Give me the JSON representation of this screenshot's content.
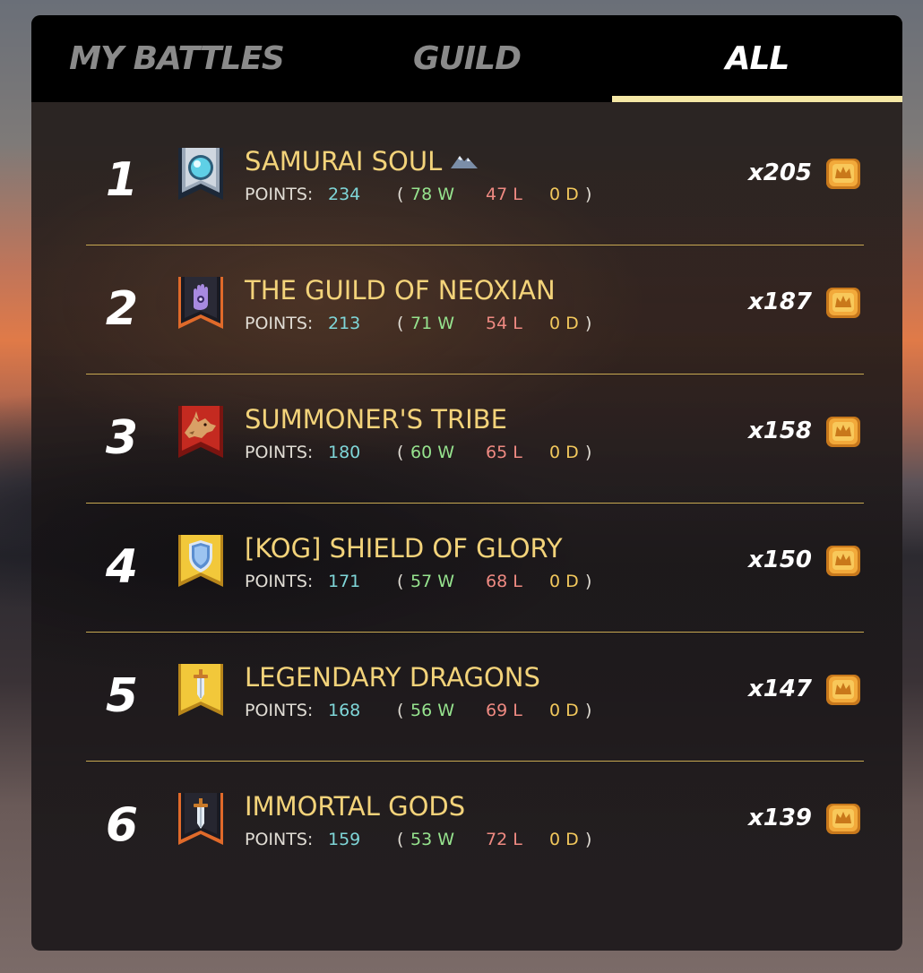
{
  "tabs": [
    {
      "label": "MY BATTLES",
      "active": false
    },
    {
      "label": "GUILD",
      "active": false
    },
    {
      "label": "ALL",
      "active": true
    }
  ],
  "colors": {
    "gold_text": "#f3d37a",
    "points": "#7fd6d8",
    "wins": "#96e38e",
    "losses": "#ef8a82",
    "draws": "#f2c85c",
    "active_tab_underline": "#f4e7a5"
  },
  "labels": {
    "points": "POINTS:",
    "paren_open": "(",
    "paren_close": ")"
  },
  "guilds": [
    {
      "rank": "1",
      "name": "SAMURAI SOUL",
      "icon": "orb-banner-icon",
      "badge_icon": "mountain-icon",
      "points": "234",
      "wins": "78 W",
      "losses": "47 L",
      "draws": "0 D",
      "reward": "x205"
    },
    {
      "rank": "2",
      "name": "THE GUILD OF NEOXIAN",
      "icon": "hand-eye-banner-icon",
      "points": "213",
      "wins": "71 W",
      "losses": "54 L",
      "draws": "0 D",
      "reward": "x187"
    },
    {
      "rank": "3",
      "name": "SUMMONER'S TRIBE",
      "icon": "wolf-banner-icon",
      "points": "180",
      "wins": "60 W",
      "losses": "65 L",
      "draws": "0 D",
      "reward": "x158"
    },
    {
      "rank": "4",
      "name": "[KOG] SHIELD OF GLORY",
      "icon": "shield-banner-icon",
      "points": "171",
      "wins": "57 W",
      "losses": "68 L",
      "draws": "0 D",
      "reward": "x150"
    },
    {
      "rank": "5",
      "name": "LEGENDARY DRAGONS",
      "icon": "sword-banner-icon",
      "points": "168",
      "wins": "56 W",
      "losses": "69 L",
      "draws": "0 D",
      "reward": "x147"
    },
    {
      "rank": "6",
      "name": "IMMORTAL GODS",
      "icon": "sword-banner-icon",
      "points": "159",
      "wins": "53 W",
      "losses": "72 L",
      "draws": "0 D",
      "reward": "x139"
    }
  ]
}
